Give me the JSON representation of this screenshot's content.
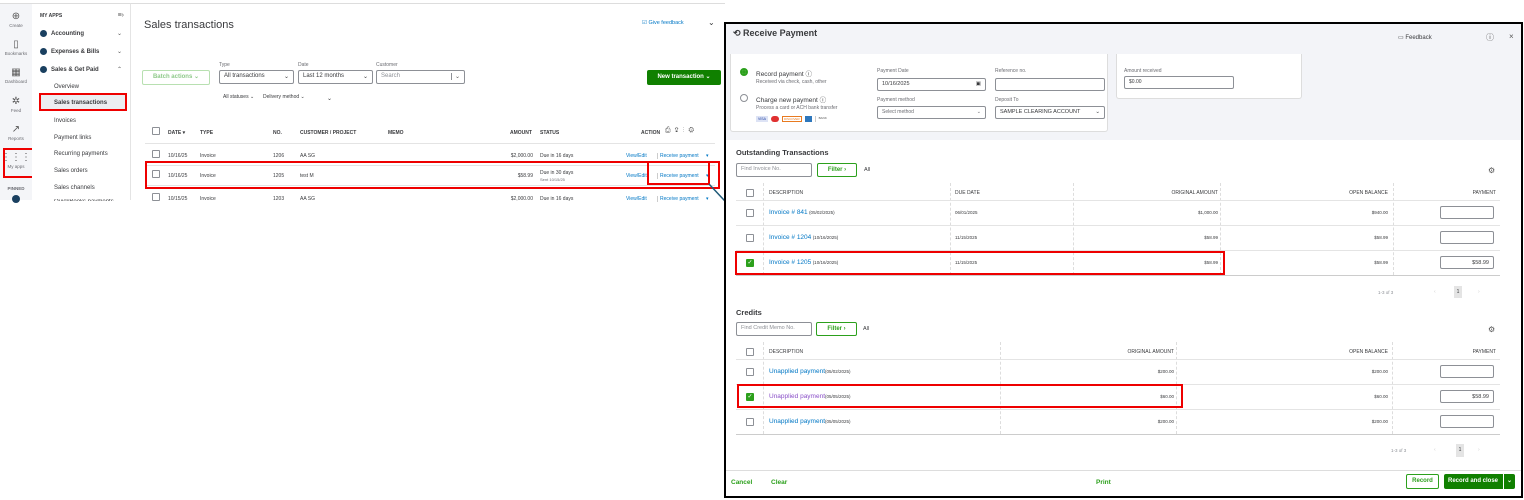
{
  "rail": [
    {
      "icon": "plus-circle",
      "label": "Create"
    },
    {
      "icon": "bookmark",
      "label": "Bookmarks"
    },
    {
      "icon": "dashboard",
      "label": "Dashboard"
    },
    {
      "icon": "feed",
      "label": "Feed"
    },
    {
      "icon": "reports",
      "label": "Reports"
    },
    {
      "icon": "grid",
      "label": "My apps"
    },
    {
      "label": "PINNED"
    }
  ],
  "nav": {
    "header": "MY APPS",
    "groups": [
      "Accounting",
      "Expenses & Bills",
      "Sales & Get Paid"
    ],
    "items": [
      "Overview",
      "Sales transactions",
      "Invoices",
      "Payment links",
      "Recurring payments",
      "Sales orders",
      "Sales channels",
      "QuickBooks payments"
    ]
  },
  "main": {
    "title": "Sales transactions",
    "feedback": "Give feedback",
    "batch": "Batch actions",
    "type_label": "Type",
    "type_value": "All transactions",
    "date_label": "Date",
    "date_value": "Last 12 months",
    "customer_label": "Customer",
    "customer_placeholder": "Search",
    "new_txn": "New transaction",
    "statuses": "All statuses",
    "delivery": "Delivery method",
    "headers": [
      "DATE ▾",
      "TYPE",
      "NO.",
      "CUSTOMER / PROJECT",
      "MEMO",
      "AMOUNT",
      "STATUS",
      "ACTION"
    ],
    "rows": [
      {
        "date": "10/16/25",
        "type": "Invoice",
        "no": "1206",
        "customer": "AA SG",
        "amount": "$2,000.00",
        "status": "Due in 16 days",
        "sub": ""
      },
      {
        "date": "10/16/25",
        "type": "Invoice",
        "no": "1205",
        "customer": "test M",
        "amount": "$58.99",
        "status": "Due in 30 days",
        "sub": "Sent 10/15/25"
      },
      {
        "date": "10/15/25",
        "type": "Invoice",
        "no": "1203",
        "customer": "AA SG",
        "amount": "$2,000.00",
        "status": "Due in 16 days",
        "sub": ""
      }
    ],
    "view_edit": "View/Edit",
    "receive": "Receive payment"
  },
  "rp": {
    "title": "Receive Payment",
    "feedback": "Feedback",
    "record_payment": "Record payment",
    "record_sub": "Received via check, cash, other",
    "charge": "Charge new payment",
    "charge_sub": "Process a card or ACH bank transfer",
    "payment_date_label": "Payment Date",
    "payment_date": "10/16/2025",
    "ref_label": "Reference no.",
    "method_label": "Payment method",
    "method_placeholder": "Select method",
    "deposit_label": "Deposit To",
    "deposit": "SAMPLE CLEARING ACCOUNT",
    "amount_label": "Amount received",
    "amount": "$0.00",
    "cards": [
      "VISA",
      "MC",
      "DISCOVER",
      "AMEX",
      "BANK"
    ],
    "outstanding": {
      "title": "Outstanding Transactions",
      "find": "Find Invoice No.",
      "filter": "Filter",
      "all": "All",
      "headers": [
        "DESCRIPTION",
        "DUE DATE",
        "ORIGINAL AMOUNT",
        "OPEN BALANCE",
        "PAYMENT"
      ],
      "rows": [
        {
          "inv": "Invoice # 841",
          "date": "(05/02/2025)",
          "due": "06/01/2025",
          "orig": "$1,000.00",
          "open": "$940.00",
          "pay": "",
          "checked": false
        },
        {
          "inv": "Invoice # 1204",
          "date": "(10/16/2025)",
          "due": "11/15/2025",
          "orig": "$58.99",
          "open": "$58.99",
          "pay": "",
          "checked": false
        },
        {
          "inv": "Invoice # 1205",
          "date": "(10/16/2025)",
          "due": "11/15/2025",
          "orig": "$58.99",
          "open": "$58.99",
          "pay": "$58.99",
          "checked": true
        }
      ],
      "pager": "1-3 of 3",
      "page": "1"
    },
    "credits": {
      "title": "Credits",
      "find": "Find Credit Memo No.",
      "filter": "Filter",
      "all": "All",
      "headers": [
        "DESCRIPTION",
        "ORIGINAL AMOUNT",
        "OPEN BALANCE",
        "PAYMENT"
      ],
      "rows": [
        {
          "desc": "Unapplied payment",
          "date": "(05/02/2025)",
          "orig": "$200.00",
          "open": "$200.00",
          "pay": "",
          "checked": false
        },
        {
          "desc": "Unapplied payment",
          "date": "(05/05/2025)",
          "orig": "$60.00",
          "open": "$60.00",
          "pay": "$58.99",
          "checked": true
        },
        {
          "desc": "Unapplied payment",
          "date": "(05/05/2025)",
          "orig": "$200.00",
          "open": "$200.00",
          "pay": "",
          "checked": false
        }
      ],
      "pager": "1-3 of 3",
      "page": "1"
    },
    "footer": {
      "cancel": "Cancel",
      "clear": "Clear",
      "print": "Print",
      "record": "Record",
      "record_close": "Record and close"
    }
  },
  "colors": {
    "green": "#2ca01c",
    "link": "#0077c5",
    "highlight": "#e00000",
    "arrow": "#1f5a78"
  }
}
